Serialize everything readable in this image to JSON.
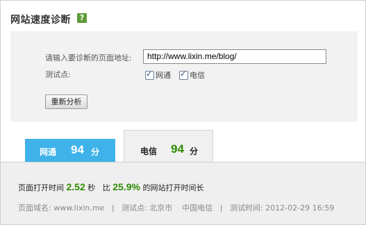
{
  "header": {
    "title": "网站速度诊断",
    "help_icon": "question-mark-icon",
    "help_glyph": "?"
  },
  "form": {
    "url_label": "请输入要诊断的页面地址:",
    "url_value": "http://www.lixin.me/blog/",
    "test_points_label": "测试点:",
    "checkboxes": [
      {
        "label": "网通",
        "checked": true
      },
      {
        "label": "电信",
        "checked": true
      }
    ],
    "reanalyze_button": "重新分析"
  },
  "tabs": [
    {
      "name": "网通",
      "score": "94",
      "unit": "分",
      "active": true,
      "color": "#3fb3e9"
    },
    {
      "name": "电信",
      "score": "94",
      "unit": "分",
      "active": false,
      "score_color": "#2e8b00"
    }
  ],
  "result": {
    "load_time_prefix": "页面打开时间",
    "load_time_value": "2.52",
    "load_time_unit": "秒",
    "compare_prefix": "比",
    "compare_value": "25.9%",
    "compare_suffix": "的网站打开时间长",
    "meta": {
      "domain": "页面域名: www.lixin.me",
      "sep1": "|",
      "test_point": "测试点: 北京市",
      "isp": "中国电信",
      "sep2": "|",
      "test_time": "测试时间: 2012-02-29 16:59"
    }
  },
  "colors": {
    "accent_blue": "#3fb3e9",
    "score_green": "#2e8b00",
    "help_green": "#5f9b3a"
  }
}
